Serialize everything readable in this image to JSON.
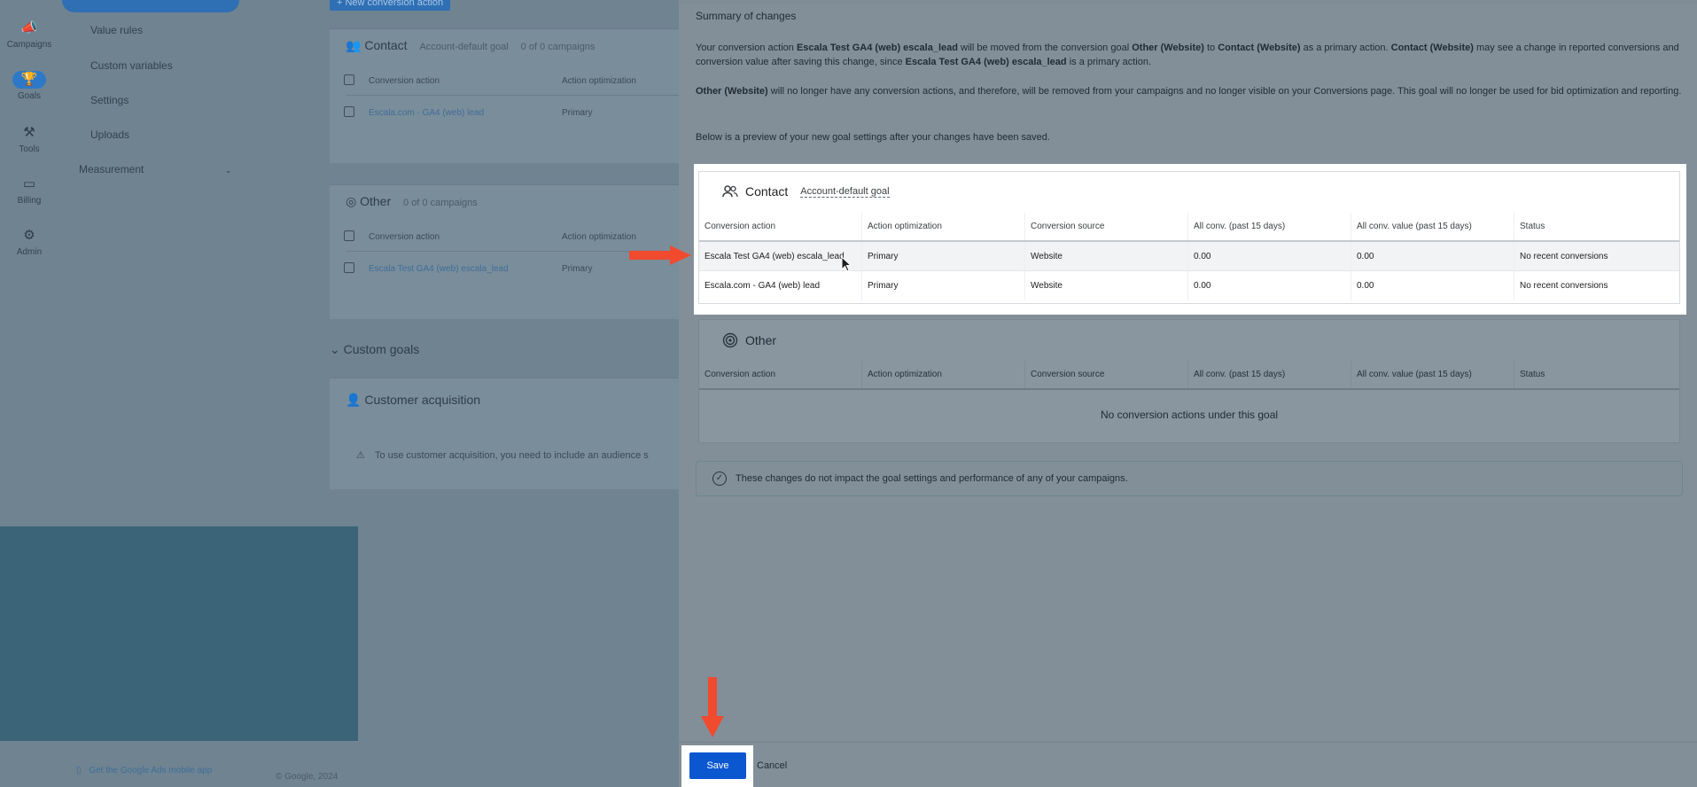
{
  "background": {
    "rail": [
      {
        "label": "Campaigns",
        "icon": "megaphone-icon"
      },
      {
        "label": "Goals",
        "icon": "trophy-icon"
      },
      {
        "label": "Tools",
        "icon": "tools-icon"
      },
      {
        "label": "Billing",
        "icon": "card-icon"
      },
      {
        "label": "Admin",
        "icon": "gear-icon"
      }
    ],
    "nav": [
      "Value rules",
      "Custom variables",
      "Settings",
      "Uploads"
    ],
    "measurement": "Measurement",
    "new_action_button": "+ New conversion action",
    "contact_card": {
      "title": "Contact",
      "tag": "Account-default goal",
      "campaigns": "0 of 0 campaigns",
      "col_action": "Conversion action",
      "col_opt": "Action optimization",
      "row_action": "Escala.com - GA4 (web) lead",
      "row_opt": "Primary"
    },
    "other_card": {
      "title": "Other",
      "campaigns": "0 of 0 campaigns",
      "col_action": "Conversion action",
      "col_opt": "Action optimization",
      "row_action": "Escala Test GA4 (web) escala_lead",
      "row_opt": "Primary"
    },
    "custom_goals": "Custom goals",
    "customer_acq": "Customer acquisition",
    "customer_acq_warning": "To use customer acquisition, you need to include an audience s",
    "mobile_app_link": "Get the Google Ads mobile app",
    "copyright": "© Google, 2024"
  },
  "panel": {
    "summary_title": "Summary of changes",
    "para1": {
      "t1": "Your conversion action ",
      "b1": "Escala Test GA4 (web) escala_lead",
      "t2": " will be moved from the conversion goal ",
      "b2": "Other (Website)",
      "t3": " to ",
      "b3": "Contact (Website)",
      "t4": " as a primary action. ",
      "b4": "Contact (Website)",
      "t5": " may see a change in reported conversions and conversion value after saving this change, since ",
      "b5": "Escala Test GA4 (web) escala_lead",
      "t6": " is a primary action."
    },
    "para2": {
      "b1": "Other (Website)",
      "t1": " will no longer have any conversion actions, and therefore, will be removed from your campaigns and no longer visible on your Conversions page. This goal will no longer be used for bid optimization and reporting."
    },
    "para3": "Below is a preview of your new goal settings after your changes have been saved.",
    "contact_table": {
      "title": "Contact",
      "tag": "Account-default goal",
      "columns": [
        "Conversion action",
        "Action optimization",
        "Conversion source",
        "All conv. (past 15 days)",
        "All conv. value (past 15 days)",
        "Status"
      ],
      "rows": [
        [
          "Escala Test GA4 (web) escala_lead",
          "Primary",
          "Website",
          "0.00",
          "0.00",
          "No recent conversions"
        ],
        [
          "Escala.com - GA4 (web) lead",
          "Primary",
          "Website",
          "0.00",
          "0.00",
          "No recent conversions"
        ]
      ]
    },
    "other_table": {
      "title": "Other",
      "columns": [
        "Conversion action",
        "Action optimization",
        "Conversion source",
        "All conv. (past 15 days)",
        "All conv. value (past 15 days)",
        "Status"
      ],
      "empty": "No conversion actions under this goal"
    },
    "notice": "These changes do not impact the goal settings and performance of any of your campaigns.",
    "save_label": "Save",
    "cancel_label": "Cancel"
  },
  "colors": {
    "accent": "#0b57d0",
    "annotation_arrow": "#f04a2f"
  }
}
